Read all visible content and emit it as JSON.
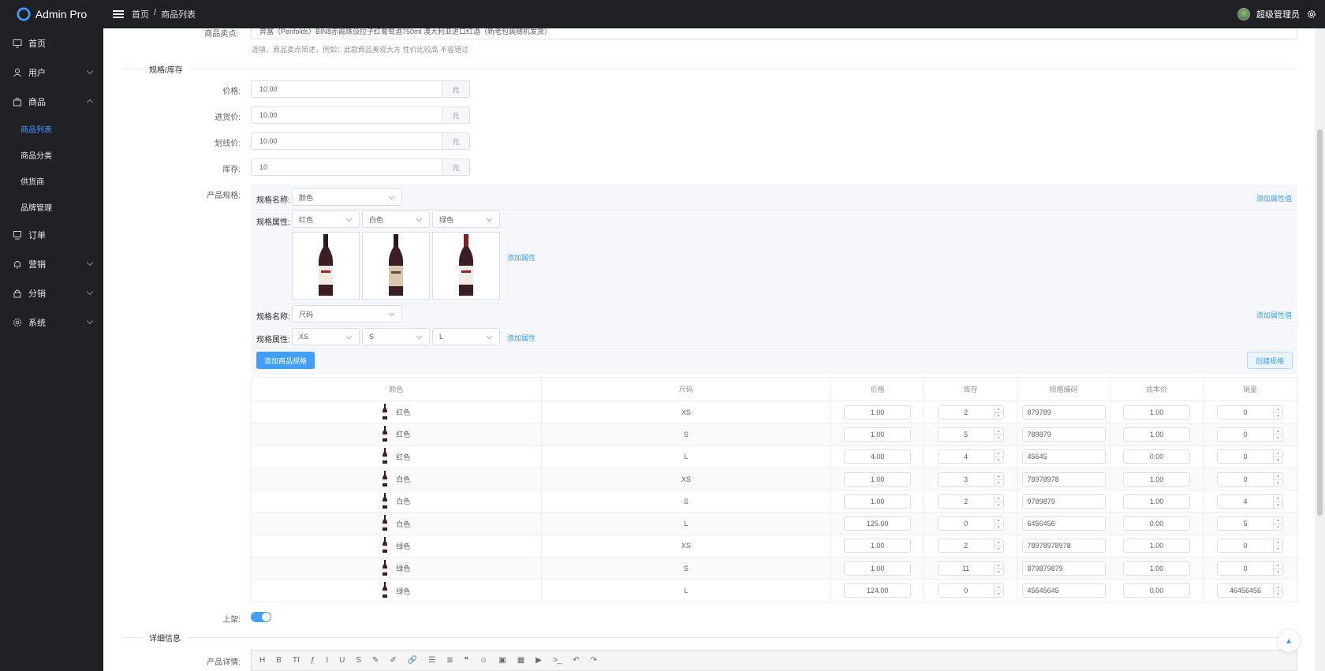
{
  "brand": {
    "name": "Admin Pro"
  },
  "header": {
    "breadcrumb": [
      "首页",
      "/",
      "商品列表"
    ],
    "user": "超级管理员"
  },
  "sidebar": {
    "items": [
      {
        "label": "首页",
        "icon": "monitor-icon"
      },
      {
        "label": "用户",
        "icon": "user-icon",
        "expandable": true
      },
      {
        "label": "商品",
        "icon": "bag-icon",
        "expanded": true
      },
      {
        "label": "订单",
        "icon": "order-icon"
      },
      {
        "label": "营销",
        "icon": "bell-icon",
        "expandable": true
      },
      {
        "label": "分销",
        "icon": "lock-icon",
        "expandable": true
      },
      {
        "label": "系统",
        "icon": "gear-icon",
        "expandable": true
      }
    ],
    "sub_items": [
      "商品列表",
      "商品分类",
      "供货商",
      "品牌管理"
    ]
  },
  "form": {
    "selling_point_label": "商品卖点:",
    "selling_point_value": "奔富（Penfolds）BIN8赤霞珠设拉子红葡萄酒750ml 澳大利亚进口红酒（新老包装随机发货）",
    "selling_point_hint": "选填，商品卖点简述，例如：此款商品美观大方 性价比较高 不容错过",
    "section_stock": "规格/库存",
    "price_label": "价格:",
    "price_value": "10.00",
    "cost_label": "进货价:",
    "cost_value": "10.00",
    "line_price_label": "划线价:",
    "line_price_value": "10.00",
    "stock_label": "库存:",
    "stock_value": "10",
    "unit": "元",
    "spec_label": "产品规格:",
    "spec_name_label": "规格名称:",
    "spec_attr_label": "规格属性:",
    "add_attr_value": "添加属性值",
    "add_attr": "添加属性",
    "spec1_name": "颜色",
    "spec1_values": [
      "红色",
      "白色",
      "绿色"
    ],
    "spec2_name": "尺码",
    "spec2_values": [
      "XS",
      "S",
      "L"
    ],
    "add_spec_button": "添加商品规格",
    "create_spec_button": "创建规格",
    "on_shelf_label": "上架:",
    "on_shelf": true,
    "section_detail": "详细信息",
    "detail_label": "产品详情:"
  },
  "sku_table": {
    "headers": [
      "颜色",
      "尺码",
      "价格",
      "库存",
      "规格编码",
      "成本价",
      "销量"
    ],
    "rows": [
      {
        "color": "红色",
        "size": "XS",
        "price": "1.00",
        "stock": "2",
        "code": "879789",
        "cost": "1.00",
        "sales": "0"
      },
      {
        "color": "红色",
        "size": "S",
        "price": "1.00",
        "stock": "5",
        "code": "789879",
        "cost": "1.00",
        "sales": "0"
      },
      {
        "color": "红色",
        "size": "L",
        "price": "4.00",
        "stock": "4",
        "code": "45645",
        "cost": "0.00",
        "sales": "0"
      },
      {
        "color": "白色",
        "size": "XS",
        "price": "1.00",
        "stock": "3",
        "code": "78978978",
        "cost": "1.00",
        "sales": "0"
      },
      {
        "color": "白色",
        "size": "S",
        "price": "1.00",
        "stock": "2",
        "code": "9789879",
        "cost": "1.00",
        "sales": "4"
      },
      {
        "color": "白色",
        "size": "L",
        "price": "125.00",
        "stock": "0",
        "code": "6456456",
        "cost": "0.00",
        "sales": "5"
      },
      {
        "color": "绿色",
        "size": "XS",
        "price": "1.00",
        "stock": "2",
        "code": "78978978978",
        "cost": "1.00",
        "sales": "0"
      },
      {
        "color": "绿色",
        "size": "S",
        "price": "1.00",
        "stock": "11",
        "code": "879879879",
        "cost": "1.00",
        "sales": "0"
      },
      {
        "color": "绿色",
        "size": "L",
        "price": "124.00",
        "stock": "0",
        "code": "45645645",
        "cost": "0.00",
        "sales": "46456456"
      }
    ]
  },
  "editor_toolbar": [
    "H",
    "B",
    "TI",
    "ƒ",
    "I",
    "U",
    "S",
    "✎",
    "✐",
    "🔗",
    "☰",
    "≣",
    "❝",
    "☺",
    "▣",
    "▦",
    "▶",
    ">_",
    "↶",
    "↷"
  ],
  "colors": {
    "accent": "#409eff",
    "sidebar_bg": "#1f2125",
    "active": "#409eff"
  }
}
